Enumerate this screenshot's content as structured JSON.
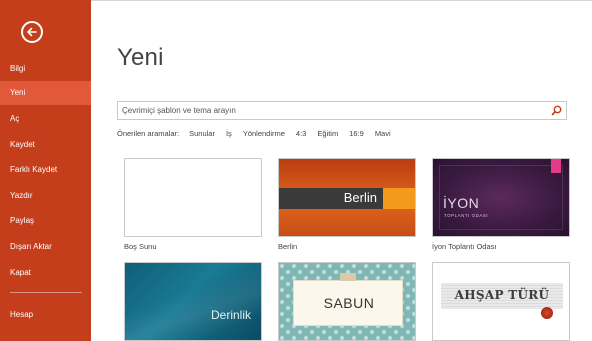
{
  "sidebar": {
    "items": [
      {
        "label": "Bilgi",
        "active": false
      },
      {
        "label": "Yeni",
        "active": true
      },
      {
        "label": "Aç",
        "active": false
      },
      {
        "label": "Kaydet",
        "active": false
      },
      {
        "label": "Farklı Kaydet",
        "active": false
      },
      {
        "label": "Yazdır",
        "active": false
      },
      {
        "label": "Paylaş",
        "active": false
      },
      {
        "label": "Dışarı Aktar",
        "active": false
      },
      {
        "label": "Kapat",
        "active": false
      },
      {
        "label": "Hesap",
        "active": false
      }
    ],
    "back_icon": "back-arrow-circle-icon"
  },
  "main": {
    "title": "Yeni",
    "search": {
      "placeholder": "Çevrimiçi şablon ve tema arayın",
      "value": "",
      "icon": "search-icon"
    },
    "suggested": {
      "label": "Önerilen aramalar:",
      "links": [
        "Sunular",
        "İş",
        "Yönlendirme",
        "4:3",
        "Eğitim",
        "16:9",
        "Mavi"
      ]
    },
    "templates": [
      {
        "name": "Boş Sunu",
        "label": ""
      },
      {
        "name": "Berlin",
        "label": "Berlin"
      },
      {
        "name": "İyon Toplantı Odası",
        "label": "İYON",
        "sub": "TOPLANTI ODASI"
      },
      {
        "name": "",
        "label": "Derinlik"
      },
      {
        "name": "",
        "label": "SABUN"
      },
      {
        "name": "",
        "label": "AHŞAP TÜRÜ"
      }
    ]
  },
  "colors": {
    "sidebar_bg": "#c43e1c",
    "sidebar_active": "#e2593a"
  }
}
